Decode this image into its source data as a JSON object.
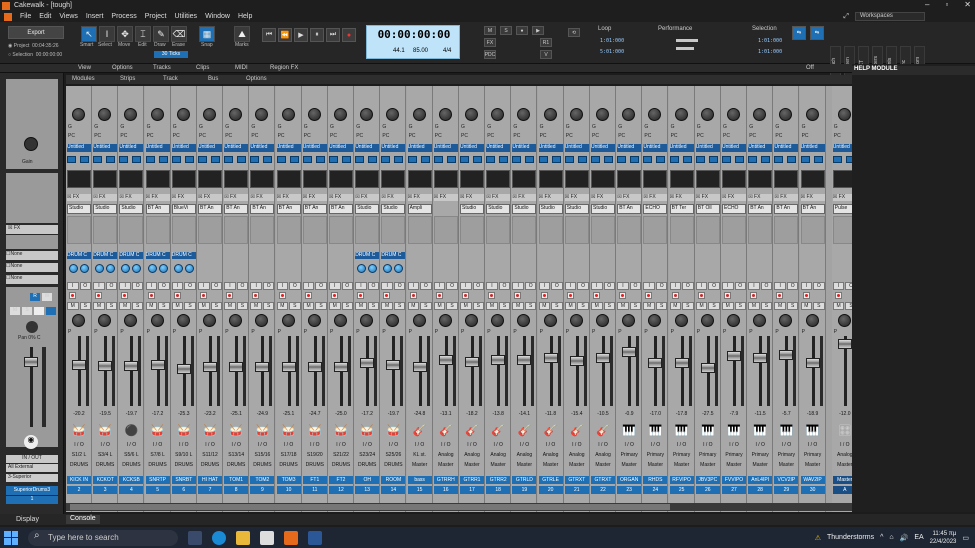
{
  "window": {
    "title": "Cakewalk - [tough]",
    "controls": [
      "–",
      "▫",
      "✕"
    ]
  },
  "menu": [
    "File",
    "Edit",
    "Views",
    "Insert",
    "Process",
    "Project",
    "Utilities",
    "Window",
    "Help"
  ],
  "workspace": {
    "label": "Workspaces"
  },
  "control_bar": {
    "export_label": "Export",
    "project_label": "Project",
    "project_time": "00:04:35:26",
    "selection_label": "Selection",
    "selection_time": "00:00:00:00",
    "tools": [
      "Smart",
      "Select",
      "Move",
      "Edit",
      "Draw",
      "Erase"
    ],
    "snap_label": "Snap",
    "snap_value": "30 Ticks",
    "marks_label": "Marks",
    "time_display": "00:00:00:00",
    "time_sig_top": "44.1",
    "time_sig_bottom": "24",
    "tempo": "85.00",
    "meter": "4/4",
    "loop_label": "Loop",
    "loop_start": "1:01:000",
    "loop_end": "5:01:000",
    "performance_label": "Performance",
    "selection_module_label": "Selection",
    "sel_start": "1:01:000",
    "sel_end": "1:01:000",
    "side_tabs": [
      "Punch",
      "Screen",
      "ACT",
      "Markers",
      "Events",
      "Sync",
      "Custom"
    ]
  },
  "view_bar": [
    "View",
    "Options",
    "Tracks",
    "Clips",
    "MIDI",
    "Region FX",
    "Off"
  ],
  "console_menu": [
    "Modules",
    "Strips",
    "Track",
    "Bus",
    "Options"
  ],
  "help_module": {
    "title": "HELP MODULE"
  },
  "inspector": {
    "gain_label": "Gain",
    "fx_label": "FX",
    "none": [
      "None",
      "None",
      "None"
    ],
    "pan_label": "Pan",
    "pan_value": "0% C",
    "io_label": "IN / OUT",
    "input": "All External",
    "output": "3-Superior",
    "track_name": "SuperiorDrums3",
    "track_num": "1"
  },
  "strips": [
    {
      "name": "KICK IN",
      "num": "2",
      "io": "S1/2 L",
      "out": "DRUMS",
      "fx": "Studio",
      "val": "-20.2",
      "icon": "🥁",
      "send": "DRUM C",
      "fader": 0.62
    },
    {
      "name": "KCKOT",
      "num": "3",
      "io": "S3/4 L",
      "out": "DRUMS",
      "fx": "Studio",
      "val": "-19.5",
      "icon": "🥁",
      "send": "DRUM C",
      "fader": 0.6
    },
    {
      "name": "KCKSB",
      "num": "4",
      "io": "S5/6 L",
      "out": "DRUMS",
      "fx": "Studio",
      "val": "-19.7",
      "icon": "⚫",
      "send": "DRUM C",
      "fader": 0.6
    },
    {
      "name": "SNRTP",
      "num": "5",
      "io": "S7/8 L",
      "out": "DRUMS",
      "fx": "BT An",
      "val": "-17.2",
      "icon": "🥁",
      "send": "DRUM C",
      "fader": 0.62
    },
    {
      "name": "SNRBT",
      "num": "6",
      "io": "S9/10 L",
      "out": "DRUMS",
      "fx": "BlueVi",
      "val": "-25.3",
      "icon": "🥁",
      "send": "DRUM C",
      "fader": 0.55
    },
    {
      "name": "HI HAT",
      "num": "7",
      "io": "S11/12",
      "out": "DRUMS",
      "fx": "BT An",
      "val": "-23.2",
      "icon": "🥁",
      "send": "",
      "fader": 0.58
    },
    {
      "name": "TOM1",
      "num": "8",
      "io": "S13/14",
      "out": "DRUMS",
      "fx": "BT An",
      "val": "-25.1",
      "icon": "🥁",
      "send": "",
      "fader": 0.58
    },
    {
      "name": "TOM2",
      "num": "9",
      "io": "S15/16",
      "out": "DRUMS",
      "fx": "BT An",
      "val": "-24.9",
      "icon": "🥁",
      "send": "",
      "fader": 0.58
    },
    {
      "name": "TOM3",
      "num": "10",
      "io": "S17/18",
      "out": "DRUMS",
      "fx": "BT An",
      "val": "-25.1",
      "icon": "🥁",
      "send": "",
      "fader": 0.58
    },
    {
      "name": "FT1",
      "num": "11",
      "io": "S19/20",
      "out": "DRUMS",
      "fx": "BT An",
      "val": "-24.7",
      "icon": "🥁",
      "send": "",
      "fader": 0.58
    },
    {
      "name": "FT2",
      "num": "12",
      "io": "S21/22",
      "out": "DRUMS",
      "fx": "BT An",
      "val": "-25.0",
      "icon": "🥁",
      "send": "",
      "fader": 0.58
    },
    {
      "name": "OH",
      "num": "13",
      "io": "S23/24",
      "out": "DRUMS",
      "fx": "Studio",
      "val": "-17.2",
      "icon": "🥁",
      "send": "DRUM C",
      "fader": 0.64
    },
    {
      "name": "ROOM",
      "num": "14",
      "io": "S25/26",
      "out": "DRUMS",
      "fx": "Studio",
      "val": "-19.7",
      "icon": "🥁",
      "send": "DRUM C",
      "fader": 0.62
    },
    {
      "name": "bass",
      "num": "15",
      "io": "KL st.",
      "out": "Master",
      "fx": "Ampli",
      "val": "-24.8",
      "icon": "🎸",
      "send": "",
      "fader": 0.58
    },
    {
      "name": "GTRRH",
      "num": "16",
      "io": "Analog",
      "out": "Master",
      "fx": "",
      "val": "-13.1",
      "icon": "🎸",
      "send": "",
      "fader": 0.7
    },
    {
      "name": "GTRR1",
      "num": "17",
      "io": "Analog",
      "out": "Master",
      "fx": "Studio",
      "val": "-18.2",
      "icon": "🎸",
      "send": "",
      "fader": 0.66
    },
    {
      "name": "GTRR2",
      "num": "18",
      "io": "Analog",
      "out": "Master",
      "fx": "Studio",
      "val": "-13.8",
      "icon": "🎸",
      "send": "",
      "fader": 0.7
    },
    {
      "name": "GTRLD",
      "num": "19",
      "io": "Analog",
      "out": "Master",
      "fx": "Studio",
      "val": "-14.1",
      "icon": "🎸",
      "send": "",
      "fader": 0.7
    },
    {
      "name": "GTRLE",
      "num": "20",
      "io": "Analog",
      "out": "Master",
      "fx": "Studio",
      "val": "-11.8",
      "icon": "🎸",
      "send": "",
      "fader": 0.72
    },
    {
      "name": "GTRXT",
      "num": "21",
      "io": "Analog",
      "out": "Master",
      "fx": "Studio",
      "val": "-15.4",
      "icon": "🎸",
      "send": "",
      "fader": 0.68
    },
    {
      "name": "GTRXT",
      "num": "22",
      "io": "Analog",
      "out": "Master",
      "fx": "Studio",
      "val": "-10.5",
      "icon": "🎸",
      "send": "",
      "fader": 0.72
    },
    {
      "name": "ORGAN",
      "num": "23",
      "io": "Primary",
      "out": "Master",
      "fx": "BT An",
      "val": "-0.9",
      "icon": "🎹",
      "send": "",
      "fader": 0.82
    },
    {
      "name": "RHDS",
      "num": "24",
      "io": "Primary",
      "out": "Master",
      "fx": "ECHO",
      "val": "-17.0",
      "icon": "🎹",
      "send": "",
      "fader": 0.64
    },
    {
      "name": "RFVIPO",
      "num": "25",
      "io": "Primary",
      "out": "Master",
      "fx": "BT Ter",
      "val": "-17.8",
      "icon": "🎹",
      "send": "",
      "fader": 0.64
    },
    {
      "name": "JBV3PC",
      "num": "26",
      "io": "Primary",
      "out": "Master",
      "fx": "BT Oll",
      "val": "-27.5",
      "icon": "🎹",
      "send": "",
      "fader": 0.56
    },
    {
      "name": "FVVIPO",
      "num": "27",
      "io": "Primary",
      "out": "Master",
      "fx": "ECHO",
      "val": "-7.9",
      "icon": "🎹",
      "send": "",
      "fader": 0.76
    },
    {
      "name": "AnL4IPI",
      "num": "28",
      "io": "Primary",
      "out": "Master",
      "fx": "BT An",
      "val": "-11.5",
      "icon": "🎹",
      "send": "",
      "fader": 0.72
    },
    {
      "name": "VCV2IP",
      "num": "29",
      "io": "Primary",
      "out": "Master",
      "fx": "BT An",
      "val": "-5.7",
      "icon": "🎹",
      "send": "",
      "fader": 0.78
    },
    {
      "name": "WAV2IP",
      "num": "30",
      "io": "Primary",
      "out": "Master",
      "fx": "BT An",
      "val": "-18.9",
      "icon": "🎹",
      "send": "",
      "fader": 0.64
    },
    {
      "name": "Master",
      "num": "A",
      "io": "Analog",
      "out": "Master",
      "fx": "Pulse",
      "val": "-12.0",
      "icon": "🎛",
      "send": "",
      "fader": 0.95
    },
    {
      "name": "DRUMS",
      "num": "B",
      "io": "",
      "out": "Master",
      "fx": "Studio",
      "val": "-3.6",
      "icon": "🥁",
      "send": "",
      "fader": 0.92
    },
    {
      "name": "DRMC",
      "num": "C",
      "io": "",
      "out": "Master",
      "fx": "Studio",
      "val": "-16.1",
      "icon": "C",
      "send": "",
      "fader": 0.75
    }
  ],
  "bottom": {
    "display_tab": "Display",
    "console_tab": "Console"
  },
  "taskbar": {
    "search_placeholder": "Type here to search",
    "weather": "Thunderstorms",
    "lang": "EA",
    "time": "11:45 πμ",
    "date": "22/4/2023"
  }
}
